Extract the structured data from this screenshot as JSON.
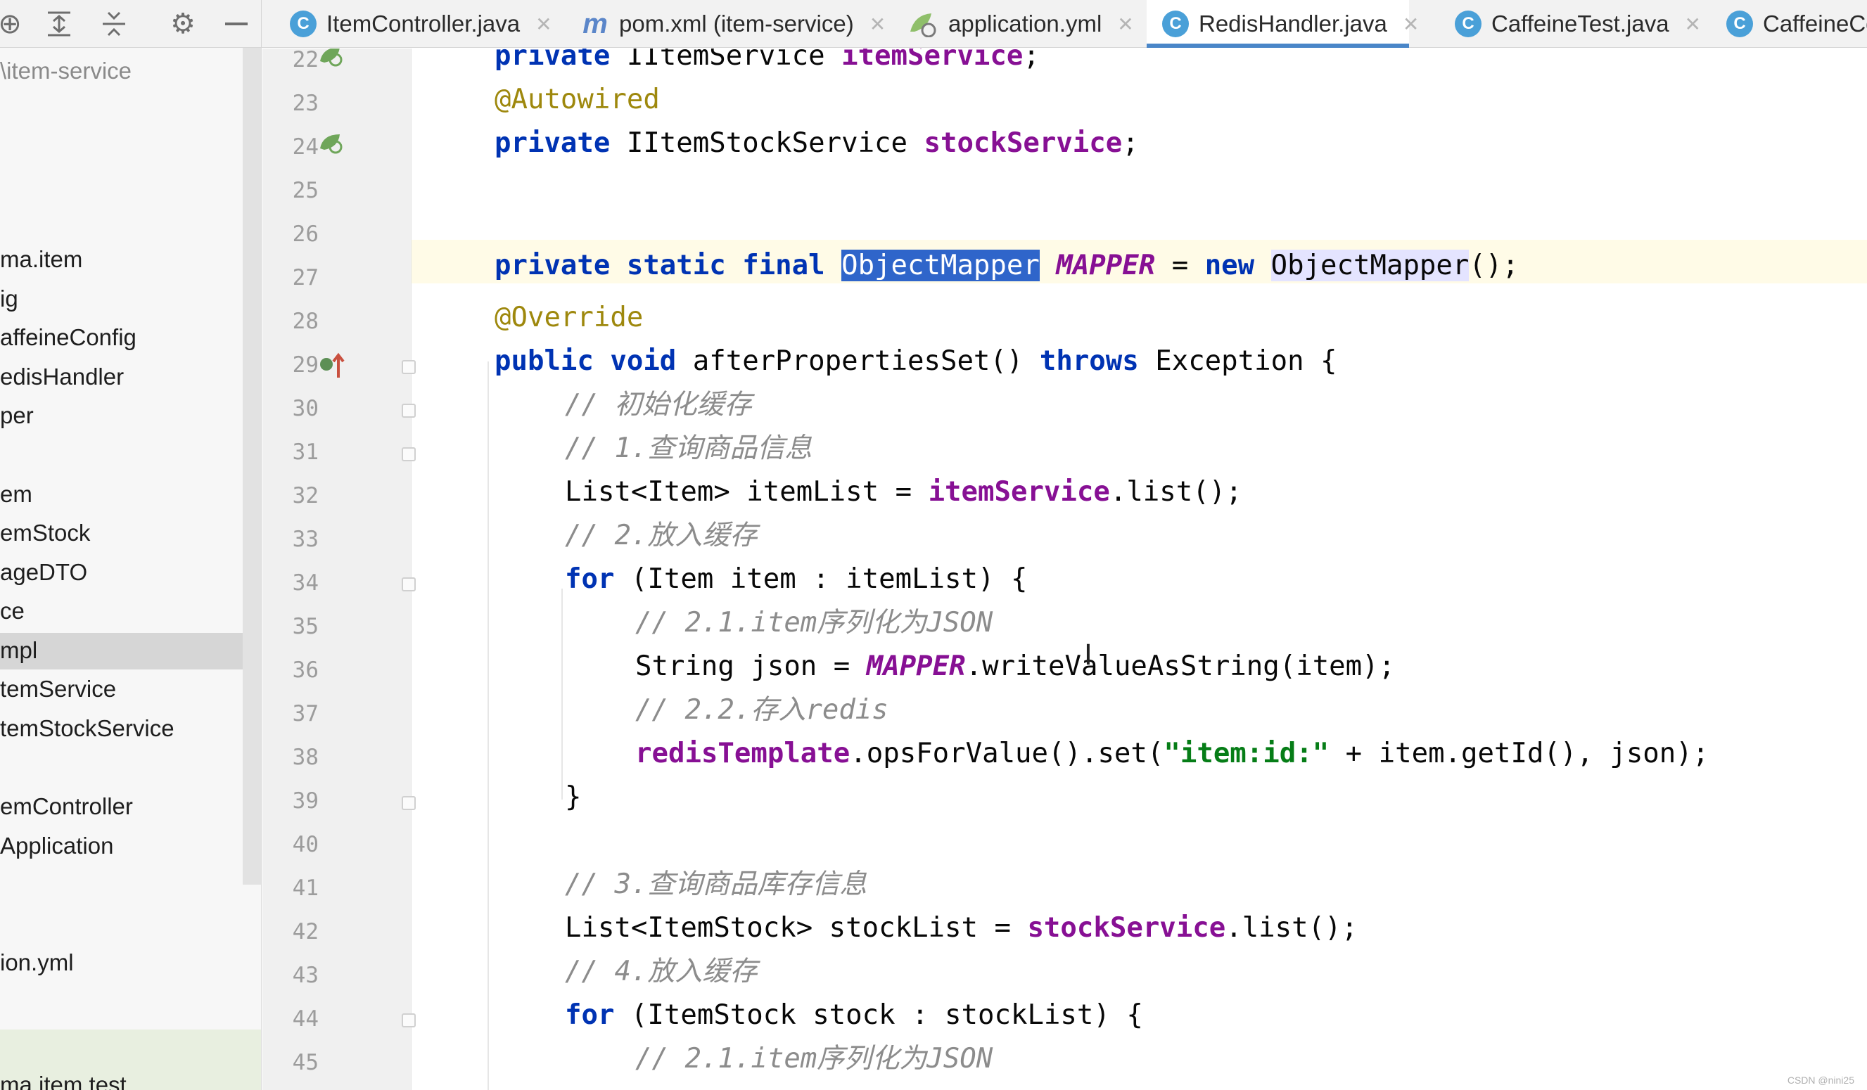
{
  "toolbar": {
    "icons": [
      "crosshair-icon",
      "expand-all-icon",
      "collapse-all-icon",
      "gear-icon",
      "minimize-icon"
    ]
  },
  "tabs": [
    {
      "label": "ItemController.java",
      "icon": "class-icon",
      "active": false
    },
    {
      "label": "pom.xml (item-service)",
      "icon": "maven-icon",
      "active": false
    },
    {
      "label": "application.yml",
      "icon": "yaml-icon",
      "active": false
    },
    {
      "label": "RedisHandler.java",
      "icon": "class-icon",
      "active": true
    },
    {
      "label": "CaffeineTest.java",
      "icon": "test-class-icon",
      "active": false
    },
    {
      "label": "CaffeineCo",
      "icon": "class-icon",
      "active": false
    }
  ],
  "sidebar": {
    "path": "\\item-service",
    "items": [
      {
        "label": "ma.item",
        "selected": false
      },
      {
        "label": "ig",
        "selected": false
      },
      {
        "label": "affeineConfig",
        "selected": false
      },
      {
        "label": "edisHandler",
        "selected": false
      },
      {
        "label": "per",
        "selected": false
      },
      {
        "label": "em",
        "selected": false
      },
      {
        "label": "emStock",
        "selected": false
      },
      {
        "label": "ageDTO",
        "selected": false
      },
      {
        "label": "ce",
        "selected": false
      },
      {
        "label": "mpl",
        "selected": true
      },
      {
        "label": "temService",
        "selected": false
      },
      {
        "label": "temStockService",
        "selected": false
      },
      {
        "label": "emController",
        "selected": false
      },
      {
        "label": "Application",
        "selected": false
      },
      {
        "label": "ion.yml",
        "selected": false
      },
      {
        "label": "ma.item.test",
        "selected": false
      }
    ]
  },
  "editor": {
    "line_numbers": [
      "22",
      "23",
      "24",
      "25",
      "26",
      "27",
      "28",
      "29",
      "30",
      "31",
      "32",
      "33",
      "34",
      "35",
      "36",
      "37",
      "38",
      "39",
      "40",
      "41",
      "42",
      "43",
      "44",
      "45"
    ],
    "code": {
      "l22": {
        "t1": "private ",
        "t2": "IItemService ",
        "t3": "itemService",
        "t4": ";"
      },
      "l23": {
        "t1": "@Autowired"
      },
      "l24": {
        "t1": "private ",
        "t2": "IItemStockService ",
        "t3": "stockService",
        "t4": ";"
      },
      "l26": {
        "t1": "private static final ",
        "t2": "ObjectMapper",
        "t3": " ",
        "t4": "MAPPER",
        "t5": " = ",
        "t6": "new ",
        "t7": "ObjectMapper",
        "t8": "();"
      },
      "l28": {
        "t1": "@Override"
      },
      "l29": {
        "t1": "public void ",
        "t2": "afterPropertiesSet() ",
        "t3": "throws ",
        "t4": "Exception {"
      },
      "l30": {
        "t1": "// 初始化缓存"
      },
      "l31": {
        "t1": "// 1.查询商品信息"
      },
      "l32": {
        "t1": "List<Item> itemList = ",
        "t2": "itemService",
        "t3": ".list();"
      },
      "l33": {
        "t1": "// 2.放入缓存"
      },
      "l34": {
        "t1": "for ",
        "t2": "(Item item : itemList) {"
      },
      "l35": {
        "t1": "// 2.1.item序列化为JSON"
      },
      "l36": {
        "t1": "String json = ",
        "t2": "MAPPER",
        "t3": ".writeValueAsString(item);"
      },
      "l37": {
        "t1": "// 2.2.存入redis"
      },
      "l38": {
        "t1": "redisTemplate",
        "t2": ".opsForValue().set(",
        "t3": "\"item:id:\"",
        "t4": " + item.getId(), json);"
      },
      "l39": {
        "t1": "}"
      },
      "l41": {
        "t1": "// 3.查询商品库存信息"
      },
      "l42": {
        "t1": "List<ItemStock> stockList = ",
        "t2": "stockService",
        "t3": ".list();"
      },
      "l43": {
        "t1": "// 4.放入缓存"
      },
      "l44": {
        "t1": "for ",
        "t2": "(ItemStock stock : stockList) {"
      },
      "l45": {
        "t1": "// 2.1.item序列化为JSON"
      }
    }
  },
  "watermark": "CSDN @nini25"
}
